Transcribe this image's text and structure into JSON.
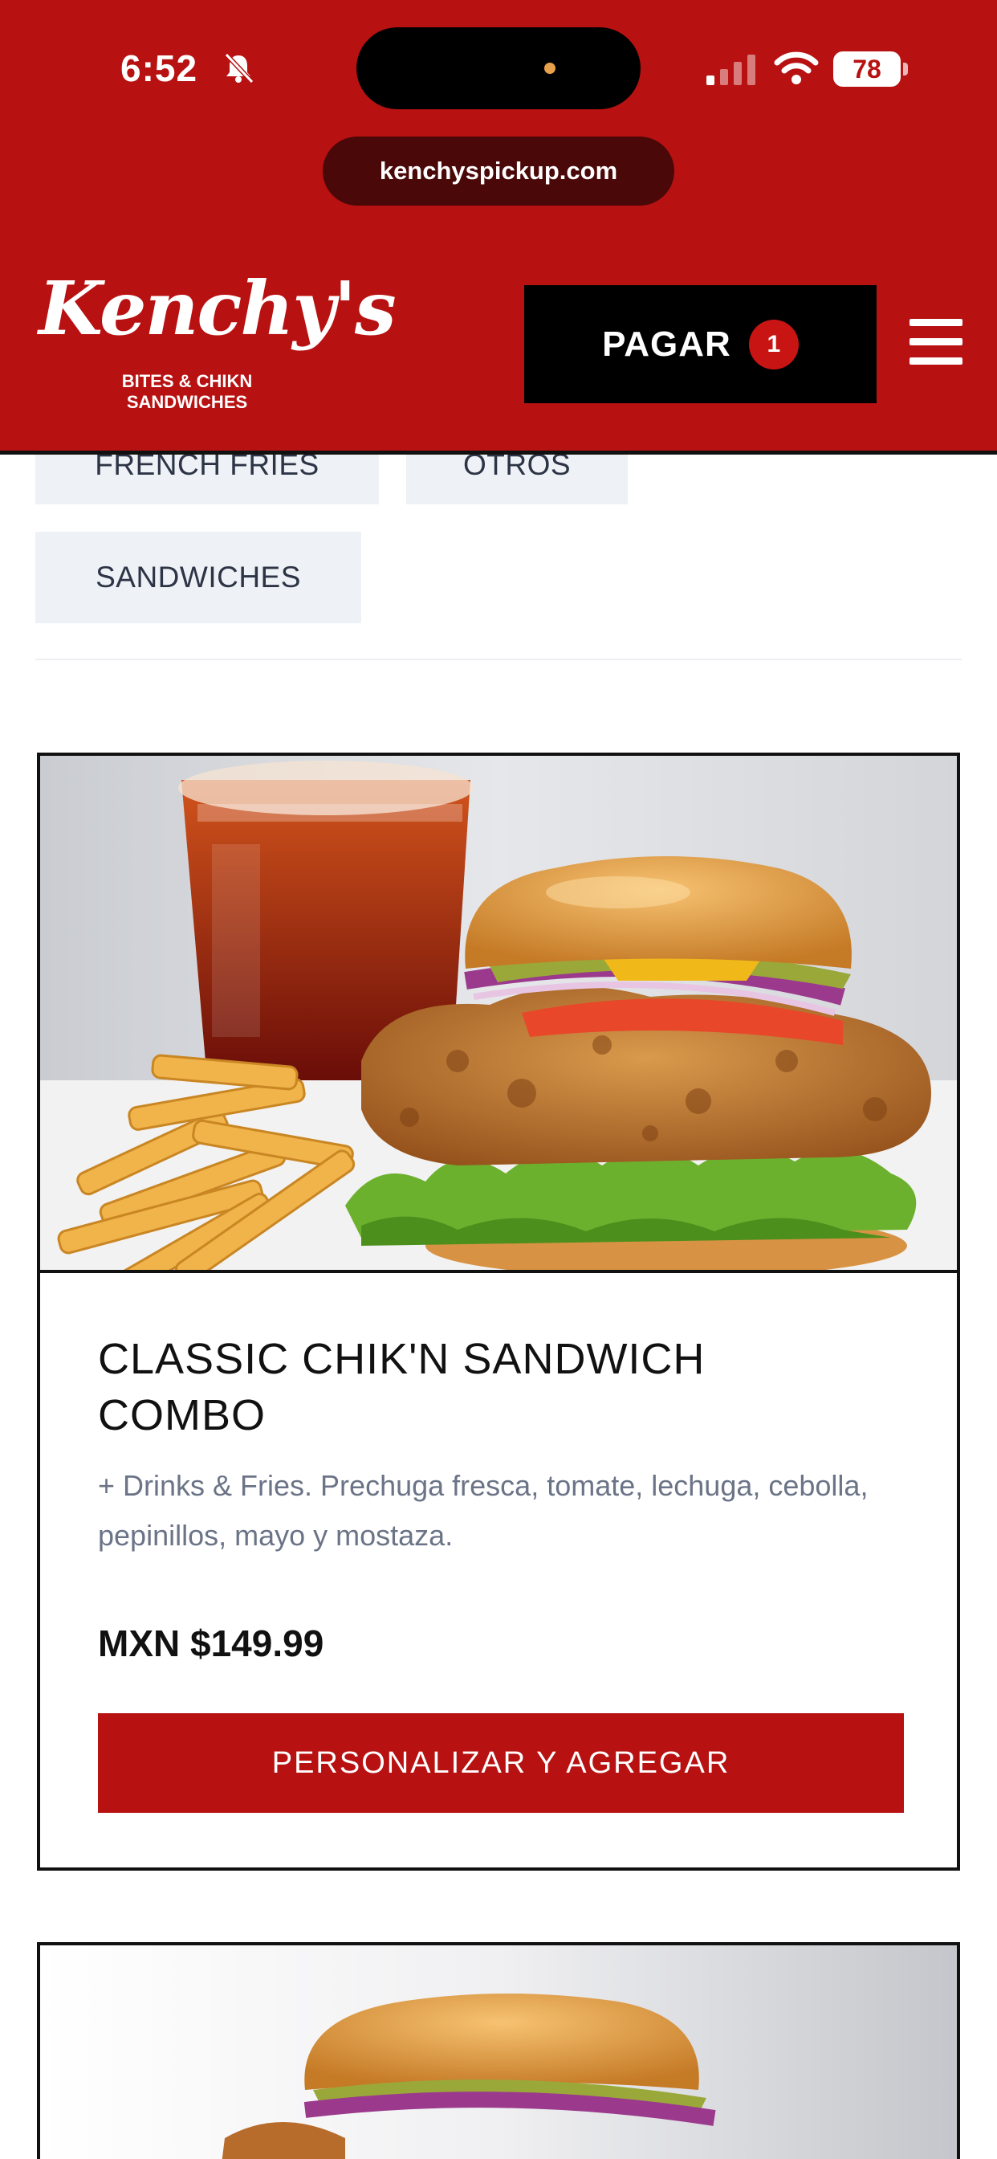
{
  "status_bar": {
    "time": "6:52",
    "battery": "78"
  },
  "browser": {
    "url": "kenchyspickup.com"
  },
  "header": {
    "logo_text": "Kenchy's",
    "logo_subtitle_line1": "BITES & CHIKN",
    "logo_subtitle_line2": "SANDWICHES",
    "cart_label": "PAGAR",
    "cart_count": "1"
  },
  "categories": [
    {
      "label": "FRENCH FRIES"
    },
    {
      "label": "OTROS"
    },
    {
      "label": "SANDWICHES"
    }
  ],
  "products": [
    {
      "title": "CLASSIC CHIK'N SANDWICH COMBO",
      "description": "+ Drinks & Fries. Prechuga fresca, tomate, lechuga, cebolla, pepinillos, mayo y mostaza.",
      "price": "MXN $149.99",
      "button_label": "PERSONALIZAR Y AGREGAR"
    }
  ],
  "colors": {
    "brand_red": "#b81111",
    "badge_red": "#c91414",
    "chip_bg": "#eef1f5",
    "text_muted": "#6b7487"
  },
  "icons": [
    "bell-slash-icon",
    "cellular-signal-icon",
    "wifi-icon",
    "battery-icon",
    "hamburger-menu-icon"
  ]
}
